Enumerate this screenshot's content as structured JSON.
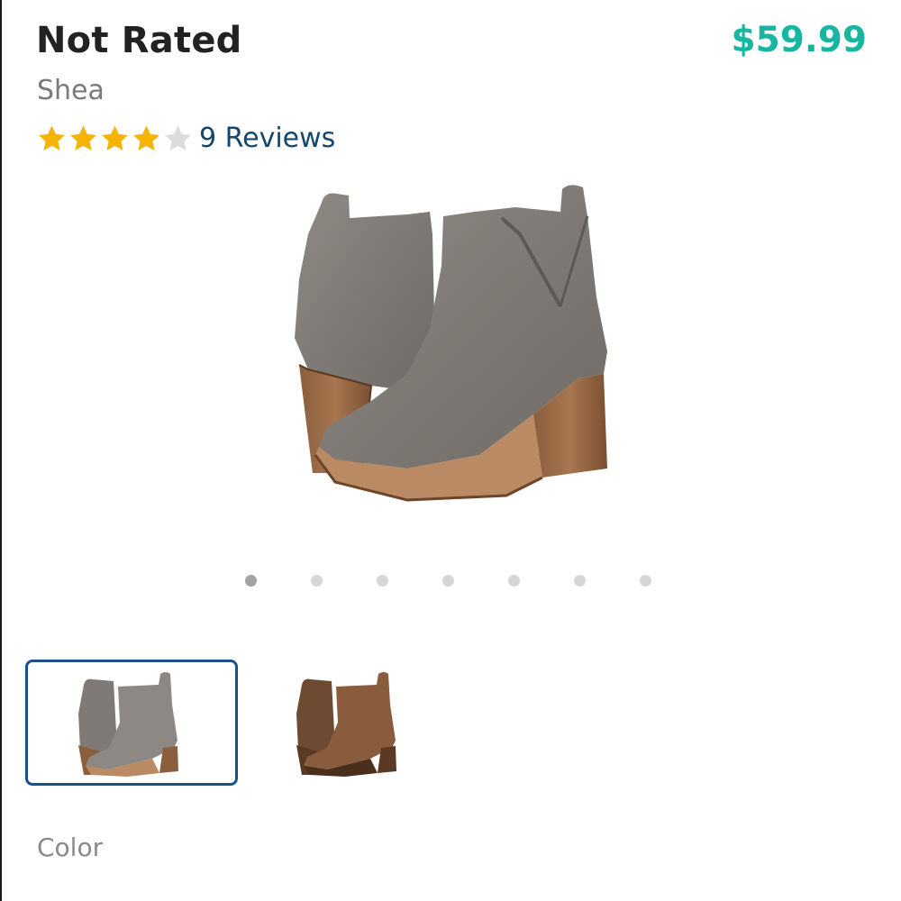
{
  "product": {
    "title": "Not Rated",
    "brand": "Shea",
    "price": "$59.99",
    "price_color": "#18b6a0",
    "rating": 4,
    "rating_max": 5,
    "reviews_label": "9 Reviews"
  },
  "gallery": {
    "image_count": 7,
    "active_index": 0
  },
  "colors": {
    "label": "Color",
    "options": [
      {
        "name": "grey-suede-boot",
        "hex": "#8c8580",
        "selected": true
      },
      {
        "name": "brown-suede-boot",
        "hex": "#8a5c3e",
        "selected": false
      }
    ]
  }
}
